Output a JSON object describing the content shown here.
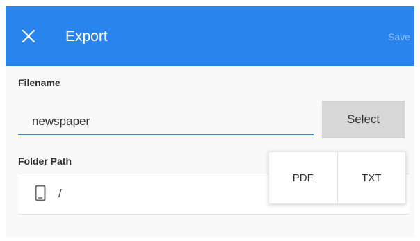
{
  "header": {
    "title": "Export",
    "save_label": "Save",
    "close_icon": "close-icon"
  },
  "filename": {
    "label": "Filename",
    "value": "newspaper",
    "select_label": "Select"
  },
  "folder": {
    "label": "Folder Path",
    "device_icon": "phone-icon",
    "path": "/"
  },
  "format_menu": {
    "options": [
      "PDF",
      "TXT"
    ]
  },
  "colors": {
    "header": "#2a84ee",
    "accent": "#3c83ee"
  }
}
